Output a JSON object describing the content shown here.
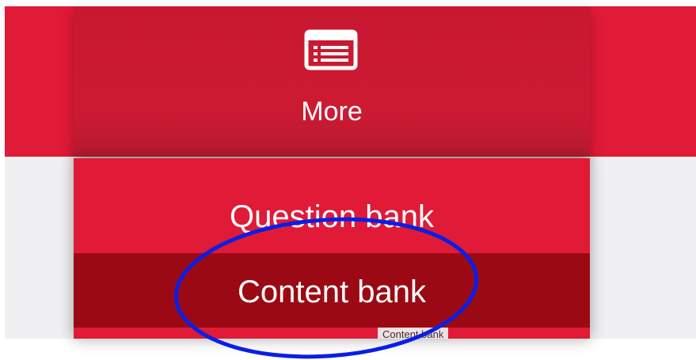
{
  "more_tab": {
    "label": "More",
    "icon": "list-icon"
  },
  "menu": {
    "items": [
      {
        "label": "Question bank"
      },
      {
        "label": "Content bank"
      }
    ]
  },
  "tooltip": {
    "text": "Content bank"
  },
  "colors": {
    "brand_red": "#e01a37",
    "tab_red": "#cc1a33",
    "active_item": "#9b0a14",
    "page_background": "#f0f0f2",
    "annotation_ellipse": "#0a1ee6"
  }
}
